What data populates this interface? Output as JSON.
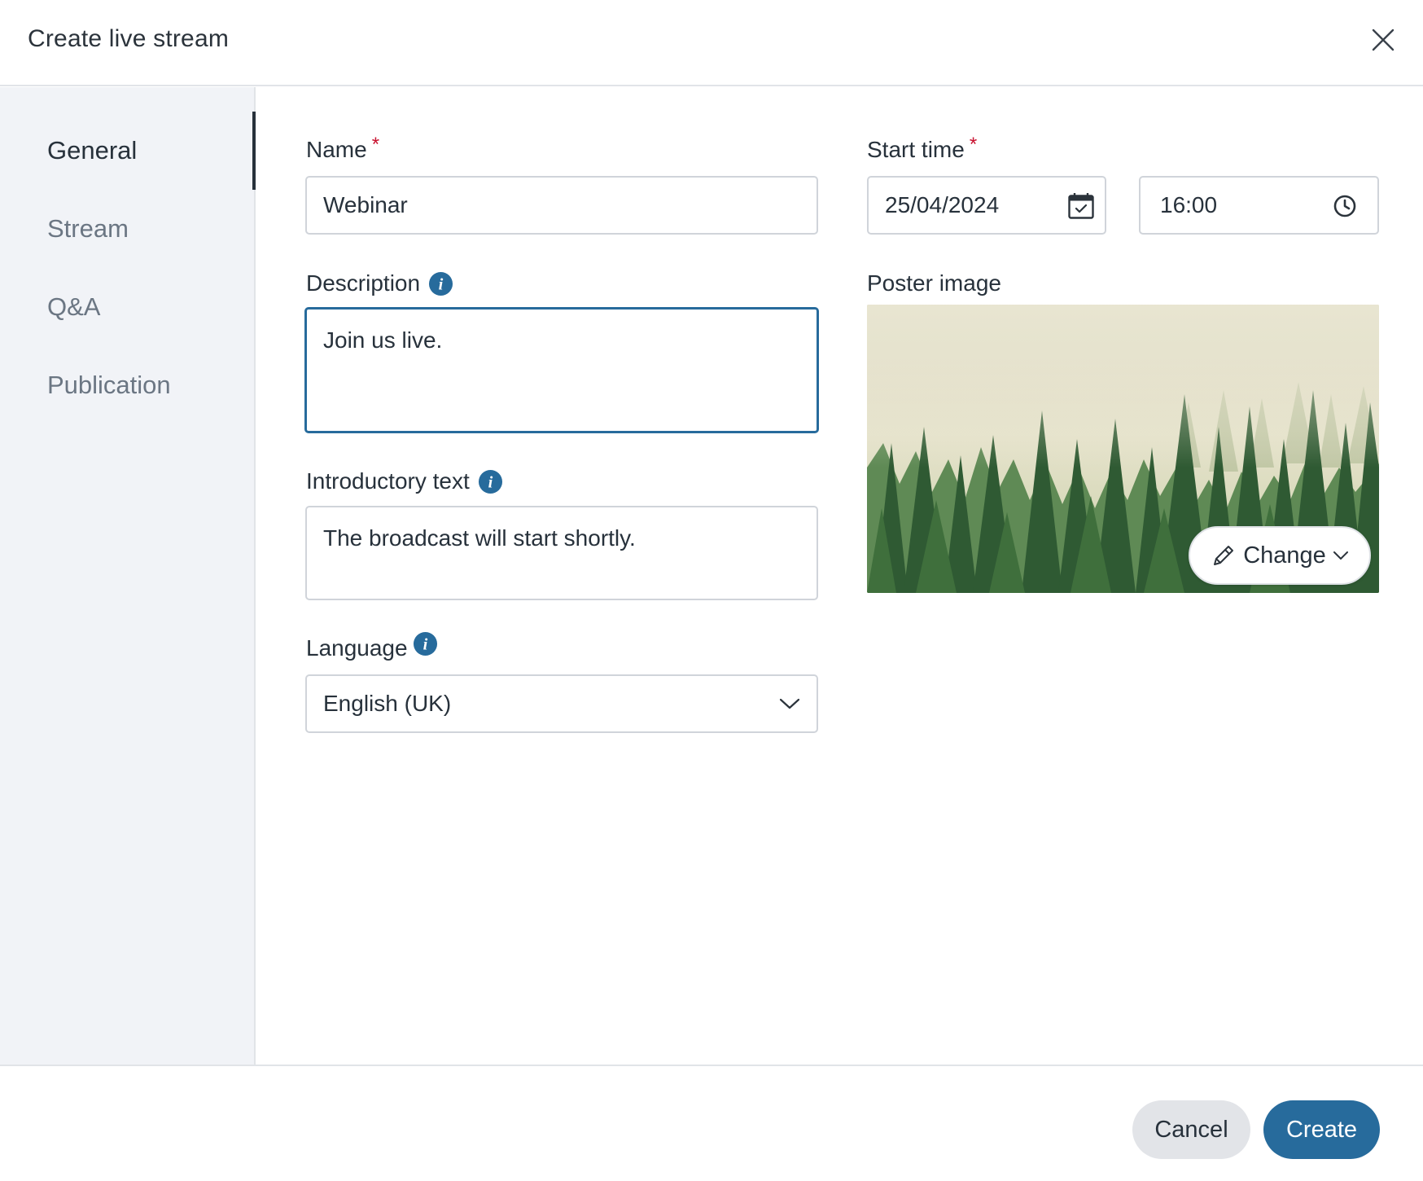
{
  "dialog": {
    "title": "Create live stream"
  },
  "sidebar": {
    "items": [
      {
        "label": "General",
        "active": true
      },
      {
        "label": "Stream",
        "active": false
      },
      {
        "label": "Q&A",
        "active": false
      },
      {
        "label": "Publication",
        "active": false
      }
    ]
  },
  "form": {
    "name": {
      "label": "Name",
      "required_mark": "*",
      "value": "Webinar"
    },
    "description": {
      "label": "Description",
      "value": "Join us live."
    },
    "intro": {
      "label": "Introductory text",
      "value": "The broadcast will start shortly."
    },
    "language": {
      "label": "Language",
      "value": "English (UK)"
    },
    "start_time": {
      "label": "Start time",
      "required_mark": "*",
      "date": "25/04/2024",
      "time": "16:00"
    },
    "poster": {
      "label": "Poster image",
      "change_label": "Change"
    }
  },
  "footer": {
    "cancel_label": "Cancel",
    "create_label": "Create"
  },
  "colors": {
    "accent": "#276b9c",
    "required": "#c8102e",
    "sidebar_bg": "#f1f3f7"
  },
  "icons": [
    "close-icon",
    "info-icon",
    "calendar-icon",
    "clock-icon",
    "chevron-down-icon",
    "pencil-icon"
  ]
}
